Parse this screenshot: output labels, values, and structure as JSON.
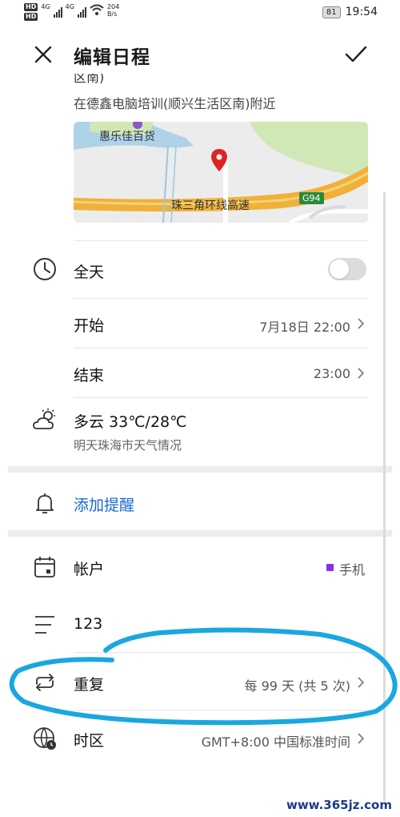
{
  "status_bar": {
    "hd1": "HD",
    "hd2": "HD",
    "net_a": "4G",
    "net_b": "4G",
    "speed_value": "204",
    "speed_unit": "B/s",
    "battery": "81",
    "time": "19:54"
  },
  "header": {
    "title": "编辑日程"
  },
  "location": {
    "cut_text": "区南)",
    "address": "在德鑫电脑培训(顺兴生活区南)附近",
    "map_label_store": "惠乐佳百货",
    "map_label_road": "珠三角环线高速",
    "map_label_shield": "G94"
  },
  "all_day": {
    "label": "全天"
  },
  "start": {
    "label": "开始",
    "value": "7月18日 22:00"
  },
  "end": {
    "label": "结束",
    "value": "23:00"
  },
  "weather": {
    "main": "多云 33℃/28℃",
    "sub": "明天珠海市天气情况"
  },
  "reminder": {
    "label": "添加提醒"
  },
  "account": {
    "label": "帐户",
    "value": "手机"
  },
  "notes": {
    "value": "123"
  },
  "repeat": {
    "label": "重复",
    "value": "每 99 天 (共 5 次)"
  },
  "timezone": {
    "label": "时区",
    "value": "GMT+8:00 中国标准时间"
  },
  "watermark": "www.365jz.com",
  "colors": {
    "accent": "#1769d3",
    "circle": "#1aa7e0",
    "account_dot": "#8b2fe0",
    "pin": "#e02424"
  }
}
